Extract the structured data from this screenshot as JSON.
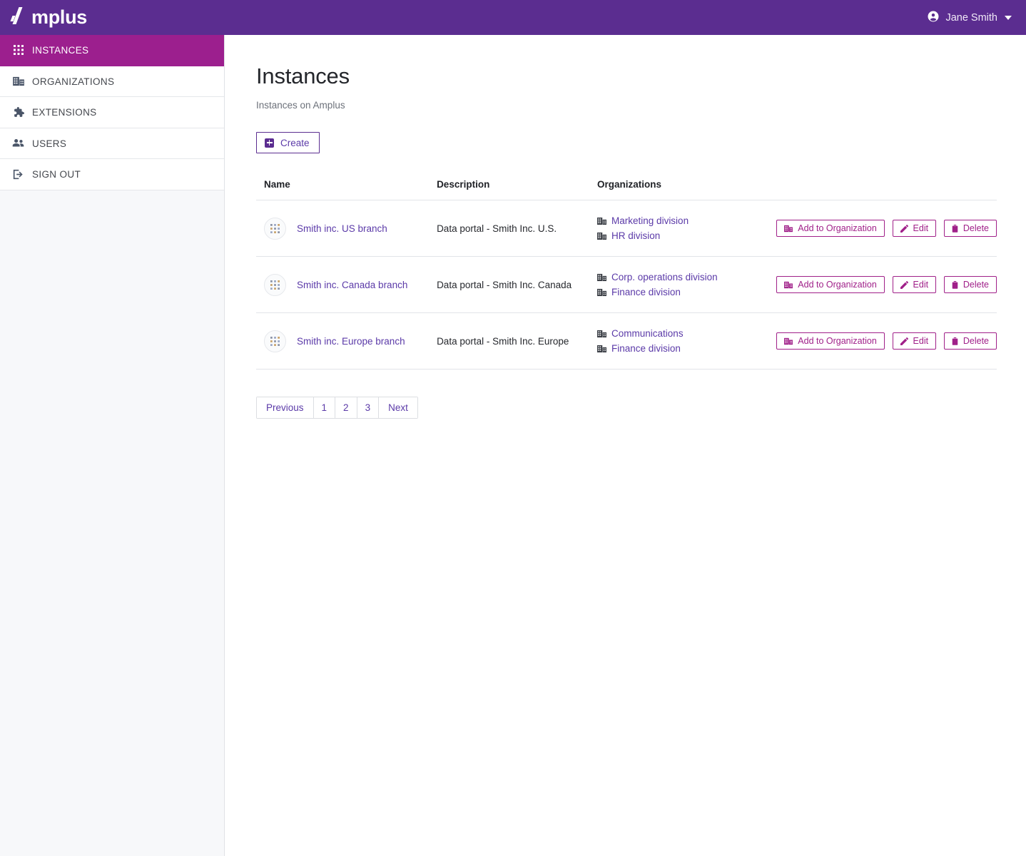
{
  "topbar": {
    "brand": "mplus",
    "brand_full": "Amplus",
    "user_name": "Jane Smith",
    "user_icon": "account-circle-icon",
    "caret_icon": "chevron-down-icon",
    "bg_color": "#5b2d90"
  },
  "sidebar": {
    "active_color": "#9c1f8e",
    "items": [
      {
        "label": "INSTANCES",
        "icon": "grid-icon",
        "active": true
      },
      {
        "label": "ORGANIZATIONS",
        "icon": "organization-icon",
        "active": false
      },
      {
        "label": "EXTENSIONS",
        "icon": "puzzle-piece-icon",
        "active": false
      },
      {
        "label": "USERS",
        "icon": "people-icon",
        "active": false
      },
      {
        "label": "SIGN OUT",
        "icon": "sign-out-icon",
        "active": false
      }
    ]
  },
  "main": {
    "title": "Instances",
    "subtitle": "Instances on Amplus",
    "create_label": "Create",
    "table": {
      "headers": {
        "name": "Name",
        "description": "Description",
        "organizations": "Organizations",
        "actions": ""
      },
      "rows": [
        {
          "name": "Smith inc. US branch",
          "description": "Data portal - Smith Inc. U.S.",
          "organizations": [
            "Marketing division",
            "HR division"
          ],
          "add_label": "Add to Organization",
          "edit_label": "Edit",
          "delete_label": "Delete"
        },
        {
          "name": "Smith inc. Canada branch",
          "description": "Data portal - Smith Inc. Canada",
          "organizations": [
            "Corp. operations division",
            "Finance division"
          ],
          "add_label": "Add to Organization",
          "edit_label": "Edit",
          "delete_label": "Delete"
        },
        {
          "name": "Smith inc. Europe branch",
          "description": "Data portal - Smith Inc. Europe",
          "organizations": [
            "Communications",
            "Finance division"
          ],
          "add_label": "Add to Organization",
          "edit_label": "Edit",
          "delete_label": "Delete"
        }
      ]
    },
    "pagination": {
      "previous": "Previous",
      "pages": [
        "1",
        "2",
        "3"
      ],
      "next": "Next"
    }
  },
  "colors": {
    "brand_purple": "#5b2d90",
    "accent_magenta": "#a02089",
    "link_purple": "#5b3aa8"
  }
}
